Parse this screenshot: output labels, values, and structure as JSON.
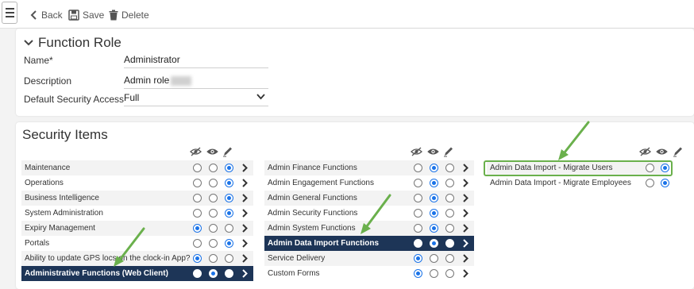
{
  "toolbar": {
    "back_label": "Back",
    "save_label": "Save",
    "delete_label": "Delete"
  },
  "role": {
    "title": "Function Role",
    "name_label": "Name*",
    "name_value": "Administrator",
    "description_label": "Description",
    "description_value": "Admin role",
    "security_label": "Default Security Access",
    "security_value": "Full"
  },
  "security": {
    "title": "Security Items",
    "column_icons": [
      "hidden-icon",
      "view-icon",
      "edit-icon"
    ],
    "columns": [
      {
        "items": [
          {
            "label": "Maintenance",
            "value": "edit"
          },
          {
            "label": "Operations",
            "value": "edit"
          },
          {
            "label": "Business Intelligence",
            "value": "edit"
          },
          {
            "label": "System Administration",
            "value": "edit"
          },
          {
            "label": "Expiry Management",
            "value": "hidden"
          },
          {
            "label": "Portals",
            "value": "edit"
          },
          {
            "label": "Ability to update GPS locs on the clock-in App?",
            "value": "hidden"
          },
          {
            "label": "Administrative Functions (Web Client)",
            "value": "view",
            "selected": true
          }
        ]
      },
      {
        "items": [
          {
            "label": "Admin Finance Functions",
            "value": "view"
          },
          {
            "label": "Admin Engagement Functions",
            "value": "view"
          },
          {
            "label": "Admin General Functions",
            "value": "view"
          },
          {
            "label": "Admin Security Functions",
            "value": "view"
          },
          {
            "label": "Admin System Functions",
            "value": "view"
          },
          {
            "label": "Admin Data Import Functions",
            "value": "view",
            "selected": true
          },
          {
            "label": "Service Delivery",
            "value": "hidden"
          },
          {
            "label": "Custom Forms",
            "value": "hidden"
          }
        ]
      },
      {
        "items": [
          {
            "label": "Admin Data Import - Migrate Users",
            "value": "view",
            "highlighted": true
          },
          {
            "label": "Admin Data Import - Migrate Employees",
            "value": "view"
          }
        ]
      }
    ]
  }
}
